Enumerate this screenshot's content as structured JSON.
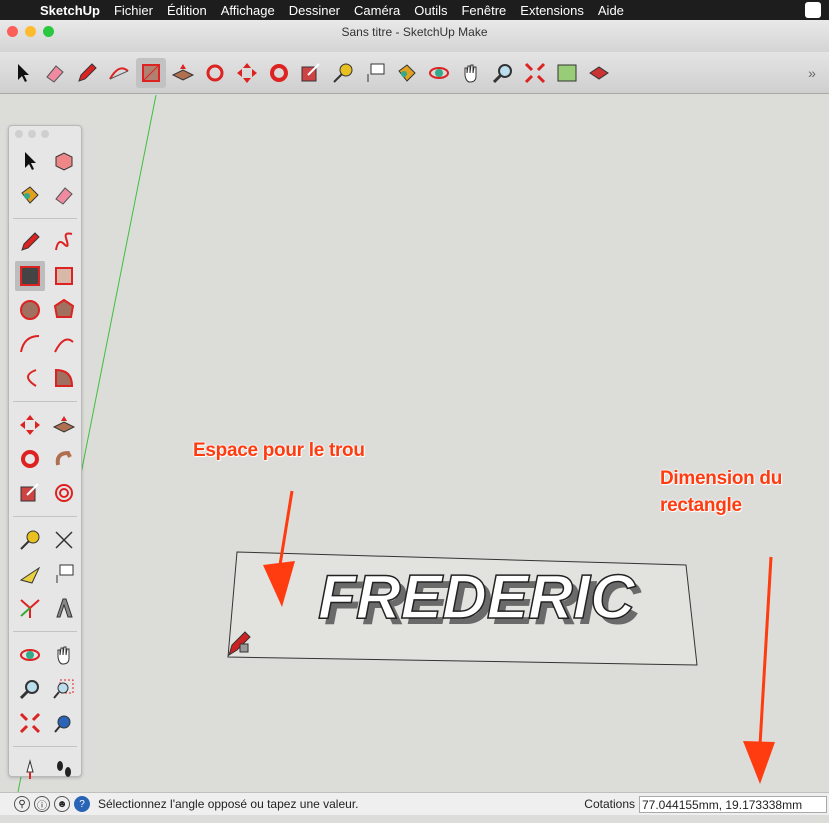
{
  "menubar": {
    "app": "SketchUp",
    "items": [
      "Fichier",
      "Édition",
      "Affichage",
      "Dessiner",
      "Caméra",
      "Outils",
      "Fenêtre",
      "Extensions",
      "Aide"
    ]
  },
  "window": {
    "title": "Sans titre - SketchUp Make"
  },
  "toolbar": {
    "icons": [
      "select-icon",
      "eraser-icon",
      "pencil-icon",
      "arc-icon",
      "rectangle-icon",
      "push-pull-icon",
      "follow-me-icon",
      "move-icon",
      "rotate-icon",
      "scale-icon",
      "tape-measure-icon",
      "text-icon",
      "paint-bucket-icon",
      "orbit-icon",
      "pan-icon",
      "zoom-icon",
      "zoom-extents-icon",
      "add-location-icon",
      "3d-warehouse-icon"
    ],
    "more": "»"
  },
  "palette": {
    "icons": [
      "select-icon",
      "component-icon",
      "paint-bucket-icon",
      "eraser-icon",
      "pencil-icon",
      "freehand-icon",
      "rectangle-icon",
      "rotated-rectangle-icon",
      "circle-icon",
      "polygon-icon",
      "arc-icon",
      "two-point-arc-icon",
      "three-point-arc-icon",
      "pie-icon",
      "move-icon",
      "push-pull-icon",
      "rotate-icon",
      "follow-me-icon",
      "scale-icon",
      "offset-icon",
      "tape-measure-icon",
      "dimension-icon",
      "protractor-icon",
      "text-icon",
      "axes-icon",
      "3d-text-icon",
      "orbit-icon",
      "pan-icon",
      "zoom-icon",
      "zoom-window-icon",
      "zoom-extents-icon",
      "previous-view-icon",
      "position-camera-icon",
      "walk-icon",
      "look-around-icon",
      "section-plane-icon"
    ]
  },
  "model": {
    "text": "FREDERIC"
  },
  "annotations": {
    "hole": "Espace pour le trou",
    "dimension_line1": "Dimension du",
    "dimension_line2": "rectangle"
  },
  "status": {
    "message": "Sélectionnez l'angle opposé ou tapez une valeur.",
    "measurements_label": "Cotations",
    "measurements_value": "77.044155mm, 19.173338mm"
  },
  "colors": {
    "accent": "#ff3b10",
    "menubar": "#1d1d1d",
    "canvas": "#dcdcd9"
  }
}
